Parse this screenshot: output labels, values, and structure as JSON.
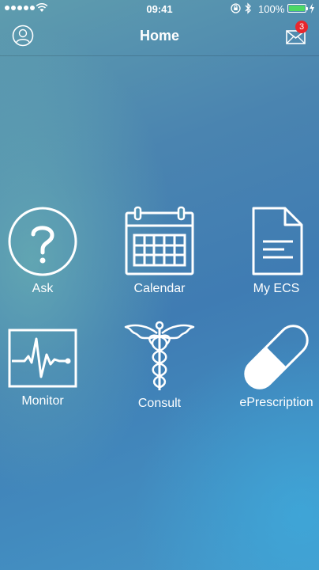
{
  "status_bar": {
    "time": "09:41",
    "battery_percent": "100%"
  },
  "nav": {
    "title": "Home",
    "message_badge": "3"
  },
  "tiles": [
    {
      "label": "Ask",
      "icon": "question-circle-icon"
    },
    {
      "label": "Calendar",
      "icon": "calendar-icon"
    },
    {
      "label": "My ECS",
      "icon": "document-icon"
    },
    {
      "label": "Monitor",
      "icon": "heartbeat-monitor-icon"
    },
    {
      "label": "Consult",
      "icon": "caduceus-icon"
    },
    {
      "label": "ePrescription",
      "icon": "pill-icon"
    }
  ],
  "colors": {
    "badge": "#e8262d",
    "battery": "#4cd964",
    "text": "#ffffff"
  }
}
